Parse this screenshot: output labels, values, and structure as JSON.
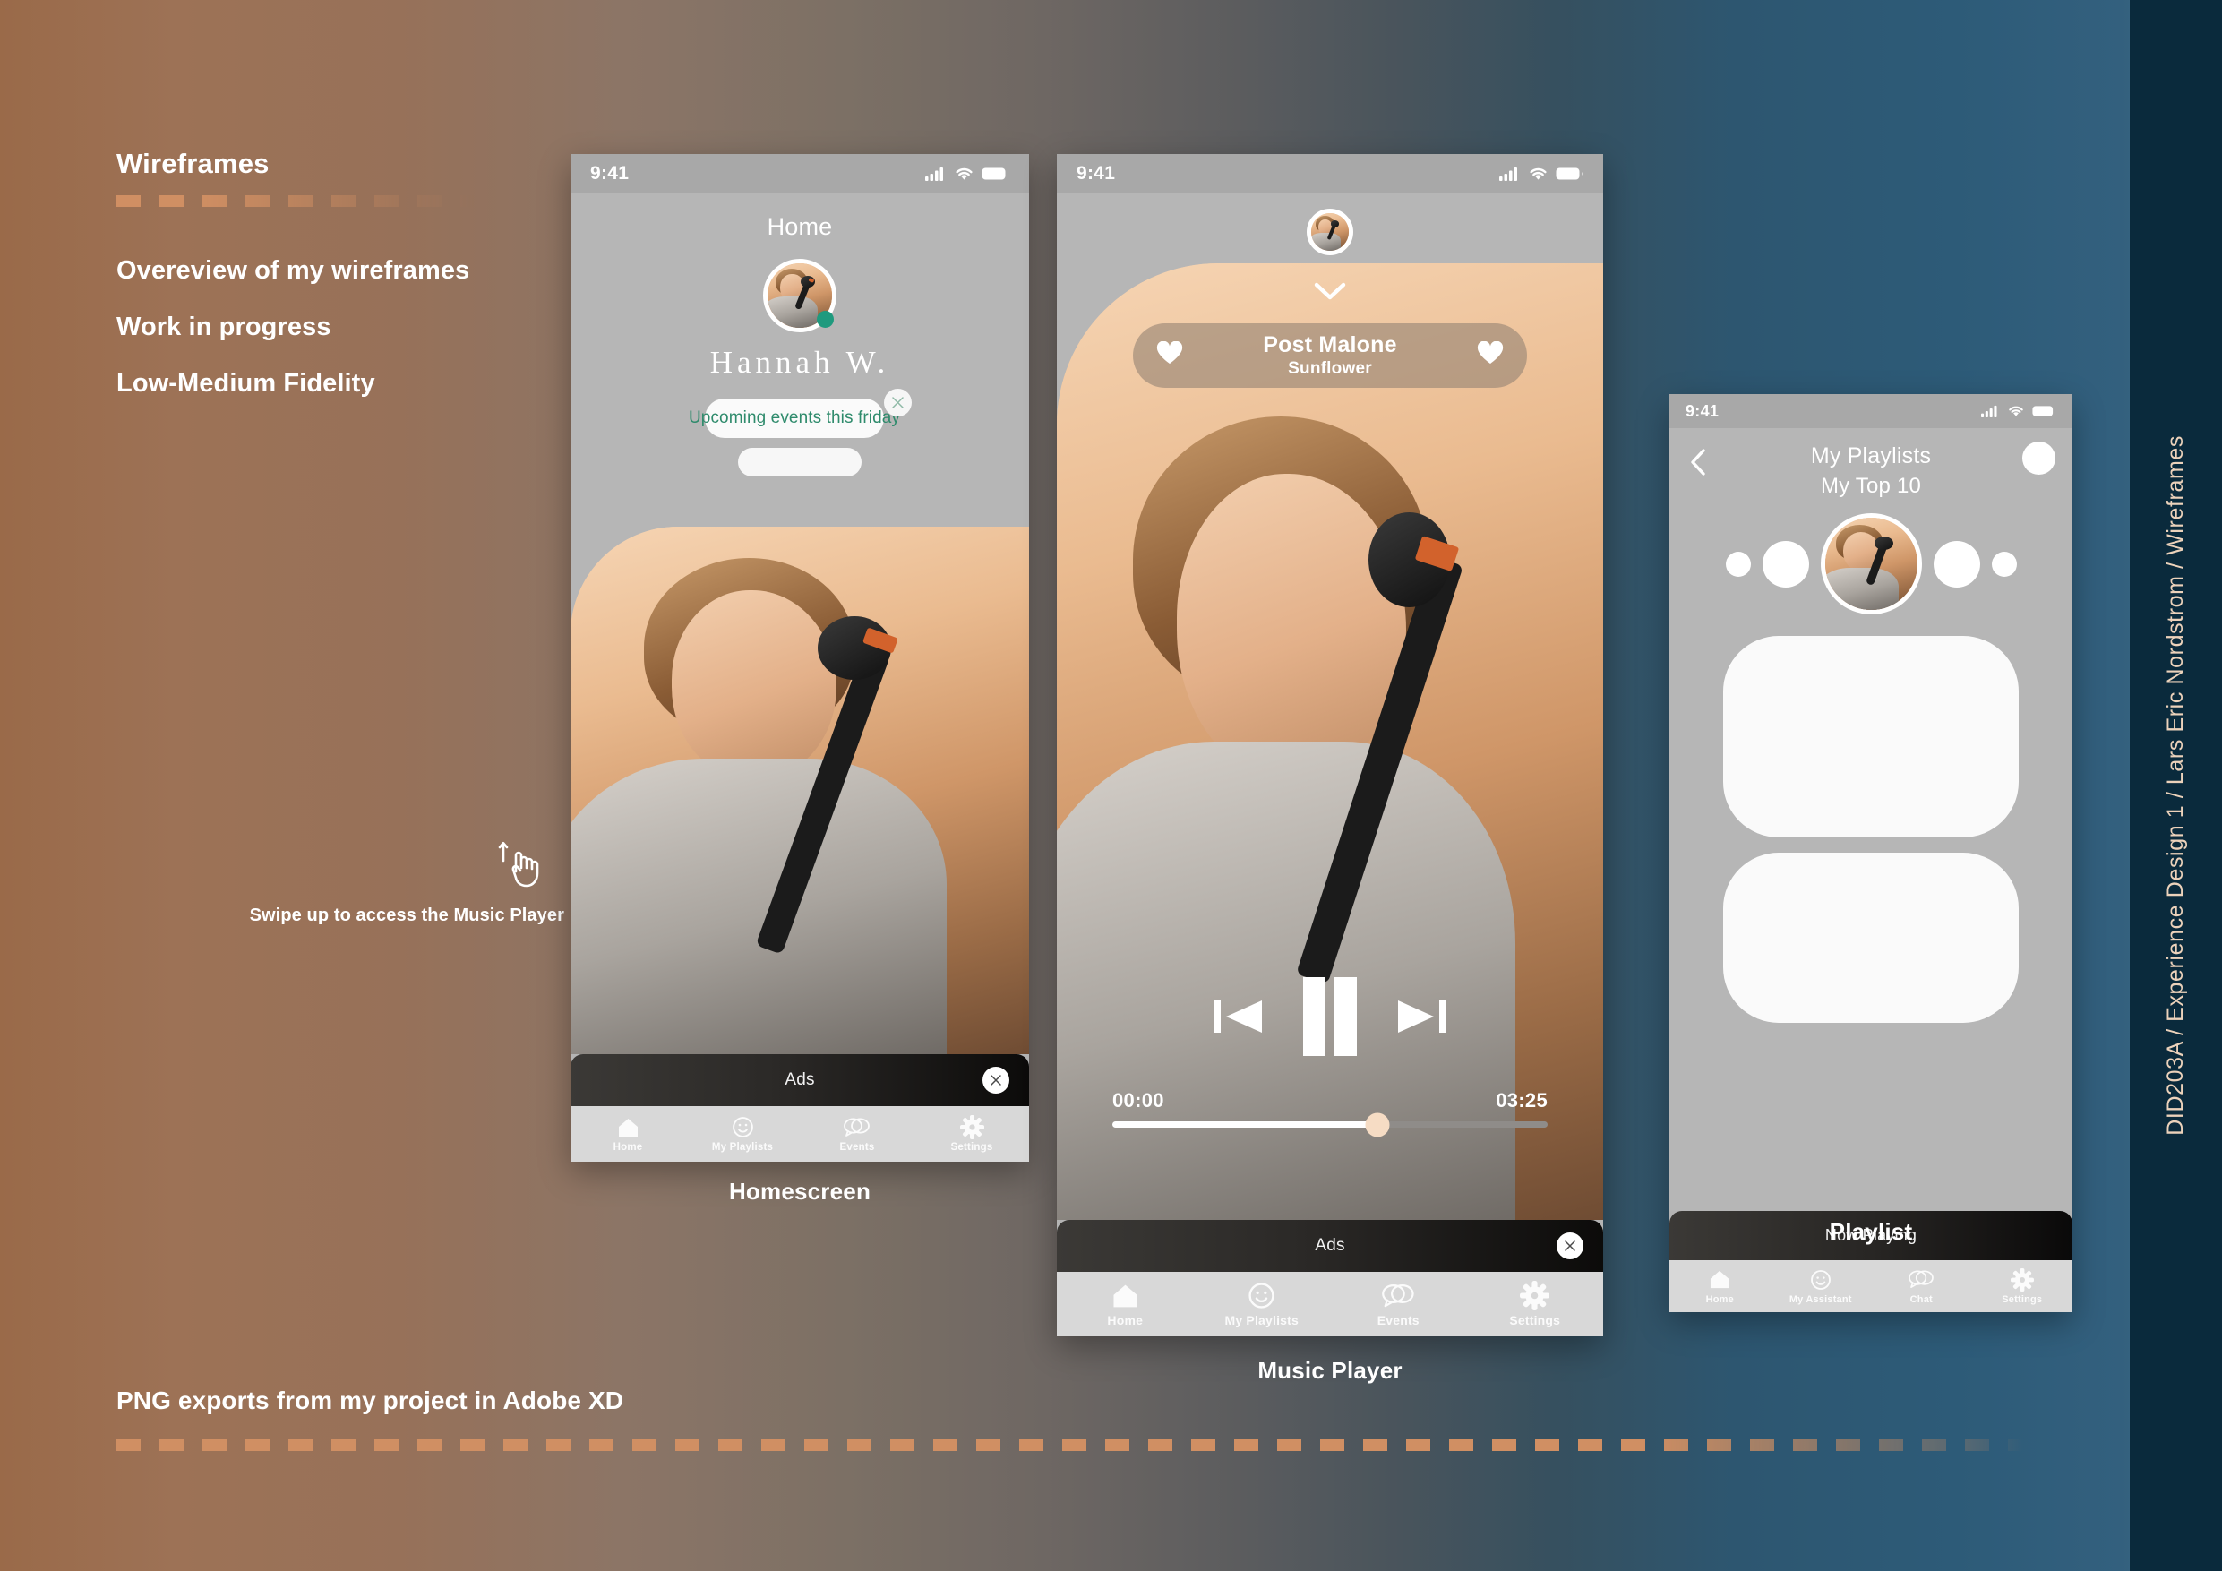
{
  "background": {
    "gradient_from": "#9a6a49",
    "gradient_to": "#2d5b78",
    "strip_color": "#0a2a3c",
    "accent_dash": "#d08f63"
  },
  "left_panel": {
    "title": "Wireframes",
    "bullets": [
      "Overeview of my wireframes",
      "Work in progress",
      "Low-Medium Fidelity"
    ],
    "swipe_hint": {
      "icon": "swipe-up-hand-icon",
      "text": "Swipe up to access the Music Player"
    },
    "footer_text": "PNG exports from my project in Adobe XD"
  },
  "side_label": {
    "text": "DID203A  /  Experience Design 1  /  Lars Eric Nordstrom  /  Wireframes",
    "color": "#ecd2bb"
  },
  "status_bar": {
    "time": "9:41",
    "icons": [
      "cellular-signal-icon",
      "wifi-icon",
      "battery-icon"
    ]
  },
  "screens": [
    {
      "caption": "Homescreen",
      "nav_title": "Home",
      "user_name": "Hannah W.",
      "online_status_color": "#1f9a7e",
      "notification": {
        "text": "Upcoming events this friday",
        "text_color": "#2f8b6c",
        "close_icon": "close-icon"
      },
      "ad_banner": {
        "label": "Ads",
        "close_icon": "close-icon"
      },
      "tabs": [
        {
          "label": "Home",
          "icon": "home-icon"
        },
        {
          "label": "My Playlists",
          "icon": "smiley-icon"
        },
        {
          "label": "Events",
          "icon": "chat-bubbles-icon"
        },
        {
          "label": "Settings",
          "icon": "gear-icon"
        }
      ]
    },
    {
      "caption": "Music Player",
      "collapse_icon": "chevron-down-icon",
      "track": {
        "artist": "Post Malone",
        "song": "Sunflower",
        "left_icon": "heart-icon",
        "right_icon": "heart-icon"
      },
      "controls": {
        "previous": "skip-back-icon",
        "play_pause": "pause-icon",
        "next": "skip-forward-icon"
      },
      "progress": {
        "elapsed": "00:00",
        "duration": "03:25",
        "percent": 61
      },
      "ad_banner": {
        "label": "Ads",
        "close_icon": "close-icon"
      },
      "tabs": [
        {
          "label": "Home",
          "icon": "home-icon"
        },
        {
          "label": "My Playlists",
          "icon": "smiley-icon"
        },
        {
          "label": "Events",
          "icon": "chat-bubbles-icon"
        },
        {
          "label": "Settings",
          "icon": "gear-icon"
        }
      ]
    },
    {
      "caption": "Playlist",
      "back_icon": "chevron-left-icon",
      "profile_icon": "avatar-icon",
      "title": "My Playlists",
      "subtitle": "My Top 10",
      "now_playing_label": "Now Playing",
      "tabs": [
        {
          "label": "Home",
          "icon": "home-icon"
        },
        {
          "label": "My Assistant",
          "icon": "smiley-icon"
        },
        {
          "label": "Chat",
          "icon": "chat-bubbles-icon"
        },
        {
          "label": "Settings",
          "icon": "gear-icon"
        }
      ]
    }
  ]
}
